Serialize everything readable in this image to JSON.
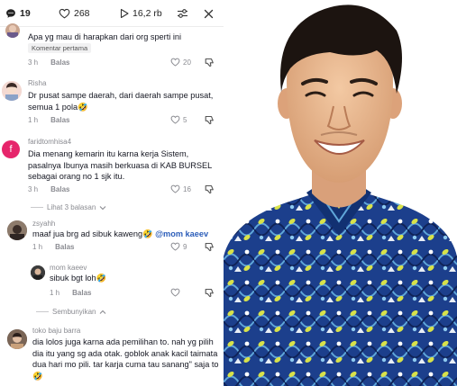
{
  "topbar": {
    "comment_count": "19",
    "like_count": "268",
    "view_count": "16,2 rb"
  },
  "comments": [
    {
      "id": "c1",
      "username": "",
      "text": "Apa yg mau di harapkan dari org sperti ini",
      "badge": "Komentar pertama",
      "time": "3 h",
      "reply": "Balas",
      "likes": "20"
    },
    {
      "id": "c2",
      "username": "Risha",
      "text": "Dr pusat sampe daerah, dari daerah sampe pusat, semua 1 pola🤣",
      "time": "1 h",
      "reply": "Balas",
      "likes": "5"
    },
    {
      "id": "c3",
      "username": "faridtomhisa4",
      "avatar_letter": "f",
      "text": "Dia menang kemarin itu karna kerja Sistem, pasalnya Ibunya masih berkuasa di KAB BURSEL sebagai orang no 1 sjk itu.",
      "time": "3 h",
      "reply": "Balas",
      "likes": "16"
    },
    {
      "id": "c4",
      "username": "zsyahh",
      "text": "maaf jua brg ad sibuk kaweng🤣",
      "mention": "@mom kaeev",
      "time": "1 h",
      "reply": "Balas",
      "likes": "9"
    },
    {
      "id": "c5",
      "username": "mom kaeev",
      "text": "sibuk bgt loh🤣",
      "time": "1 h",
      "reply": "Balas",
      "likes": ""
    },
    {
      "id": "c6",
      "username": "toko baju barra",
      "text": "dia lolos juga karna ada pemilihan to. nah yg pilih dia itu yang sg ada otak. goblok anak kacil taimata dua hari mo pili. tar karja cuma tau sanang\" saja to🤣",
      "likes": ""
    }
  ],
  "links": {
    "view_replies": "Lihat 3 balasan",
    "hide": "Sembunyikan"
  },
  "colors": {
    "text": "#161823",
    "muted": "#8a8b91",
    "mention": "#2b5db9",
    "avatar_f": "#e6256b",
    "batik_blue": "#1c3f8c",
    "batik_accent": "#d8e24a"
  },
  "icons": {
    "comment": "comment-bubble-icon",
    "like": "heart-icon",
    "views": "play-icon",
    "filter": "sliders-icon",
    "close": "close-icon",
    "dislike": "thumb-down-icon"
  }
}
